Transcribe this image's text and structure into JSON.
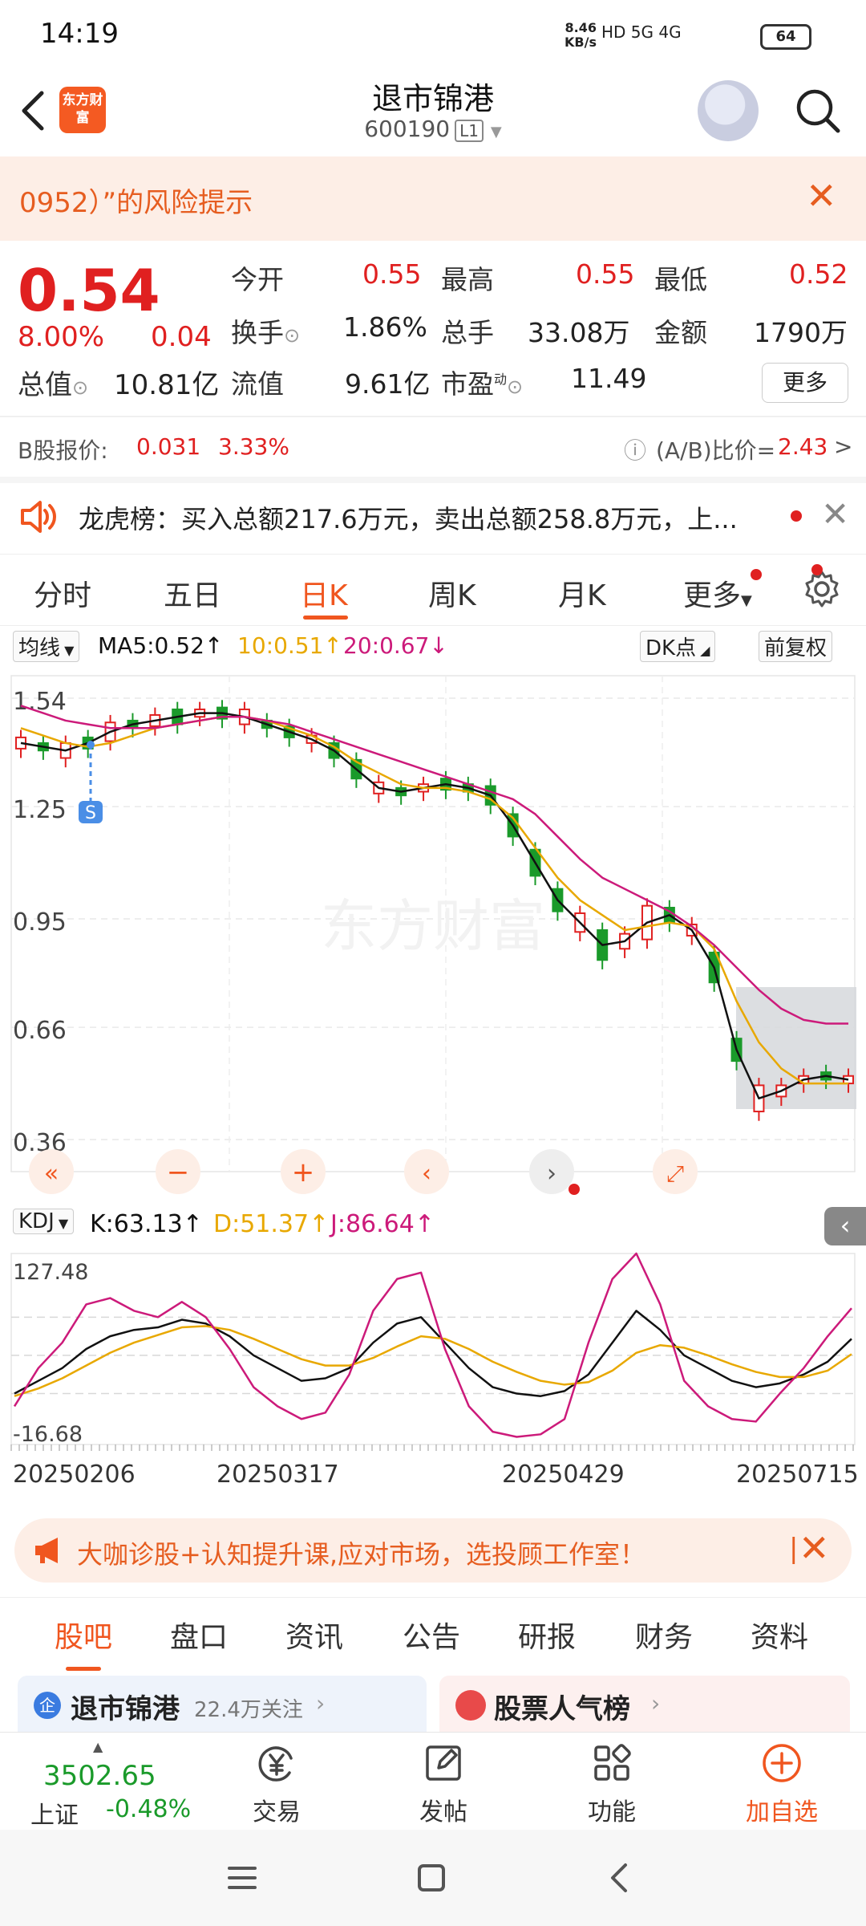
{
  "status_bar": {
    "time": "14:19",
    "net_speed_value": "8.46",
    "net_speed_unit": "KB/s",
    "network": "HD 5G 4G",
    "battery": "64"
  },
  "header": {
    "logo_text": "东方财富",
    "title": "退市锦港",
    "code": "600190",
    "level": "L1"
  },
  "risk_banner": {
    "text": "0952）”的风险提示"
  },
  "quote": {
    "price": "0.54",
    "change_pct": "8.00%",
    "change": "0.04",
    "open_label": "今开",
    "open": "0.55",
    "high_label": "最高",
    "high": "0.55",
    "low_label": "最低",
    "low": "0.52",
    "turnover_label": "换手",
    "turnover": "1.86%",
    "volume_label": "总手",
    "volume": "33.08万",
    "amount_label": "金额",
    "amount": "1790万",
    "mktcap_label": "总值",
    "mktcap": "10.81亿",
    "float_label": "流值",
    "float": "9.61亿",
    "pe_label": "市盈",
    "pe_sup": "动",
    "pe": "11.49",
    "more_label": "更多"
  },
  "b_share": {
    "label": "B股报价:",
    "price": "0.031",
    "pct": "3.33%",
    "ratio_label": "(A/B)比价=",
    "ratio": "2.43",
    "arrow": ">"
  },
  "dragon_list": {
    "text": "龙虎榜：买入总额217.6万元，卖出总额258.8万元，上..."
  },
  "chart_tabs": [
    "分时",
    "五日",
    "日K",
    "周K",
    "月K",
    "更多"
  ],
  "ma_bar": {
    "selector": "均线",
    "ma5": "MA5:0.52",
    "ma10": "10:0.51",
    "ma20": "20:0.67",
    "dk": "DK点",
    "adjust": "前复权"
  },
  "kdj_bar": {
    "selector": "KDJ",
    "k": "K:63.13",
    "d": "D:51.37",
    "j": "J:86.64"
  },
  "colors": {
    "up": "#e02020",
    "down": "#1a9a2a",
    "ma5": "#111111",
    "ma10": "#e8a800",
    "ma20": "#cc1a7a",
    "accent": "#f0561f"
  },
  "chart_data": [
    {
      "type": "candlestick",
      "price_ticks": [
        "1.54",
        "1.25",
        "0.95",
        "0.66",
        "0.36"
      ],
      "marker": "S",
      "ma5": [
        1.42,
        1.41,
        1.4,
        1.42,
        1.45,
        1.47,
        1.48,
        1.49,
        1.5,
        1.5,
        1.49,
        1.47,
        1.45,
        1.43,
        1.4,
        1.35,
        1.3,
        1.29,
        1.3,
        1.31,
        1.3,
        1.28,
        1.2,
        1.1,
        1.0,
        0.94,
        0.88,
        0.89,
        0.94,
        0.96,
        0.92,
        0.82,
        0.6,
        0.47,
        0.49,
        0.52,
        0.53,
        0.52
      ],
      "ma10": [
        1.46,
        1.44,
        1.42,
        1.41,
        1.42,
        1.44,
        1.46,
        1.47,
        1.48,
        1.49,
        1.49,
        1.48,
        1.46,
        1.44,
        1.41,
        1.37,
        1.34,
        1.31,
        1.3,
        1.3,
        1.29,
        1.27,
        1.22,
        1.14,
        1.06,
        1.0,
        0.96,
        0.92,
        0.93,
        0.94,
        0.93,
        0.87,
        0.73,
        0.62,
        0.55,
        0.51,
        0.51,
        0.51
      ],
      "ma20": [
        1.52,
        1.5,
        1.48,
        1.47,
        1.46,
        1.46,
        1.46,
        1.47,
        1.48,
        1.49,
        1.49,
        1.48,
        1.47,
        1.45,
        1.43,
        1.41,
        1.39,
        1.37,
        1.35,
        1.33,
        1.31,
        1.29,
        1.27,
        1.23,
        1.17,
        1.11,
        1.06,
        1.03,
        1.0,
        0.97,
        0.93,
        0.88,
        0.82,
        0.76,
        0.71,
        0.68,
        0.67,
        0.67
      ]
    },
    {
      "type": "line",
      "y_ticks": [
        "127.48",
        "-16.68"
      ],
      "x_ticks": [
        "20250206",
        "20250317",
        "20250429",
        "20250715"
      ],
      "k": [
        20,
        30,
        40,
        55,
        65,
        70,
        72,
        78,
        75,
        65,
        50,
        40,
        30,
        32,
        40,
        60,
        75,
        80,
        60,
        40,
        25,
        20,
        18,
        22,
        35,
        60,
        85,
        70,
        50,
        40,
        30,
        25,
        28,
        35,
        45,
        63
      ],
      "d": [
        18,
        24,
        32,
        42,
        52,
        60,
        66,
        72,
        73,
        70,
        63,
        55,
        47,
        42,
        42,
        48,
        57,
        65,
        63,
        55,
        45,
        37,
        30,
        27,
        29,
        38,
        52,
        58,
        56,
        50,
        43,
        37,
        33,
        33,
        38,
        51
      ],
      "j": [
        10,
        40,
        60,
        90,
        95,
        85,
        80,
        92,
        80,
        55,
        25,
        10,
        0,
        5,
        35,
        85,
        110,
        115,
        55,
        10,
        -10,
        -14,
        -12,
        0,
        60,
        110,
        130,
        90,
        30,
        10,
        0,
        -2,
        20,
        40,
        65,
        87
      ]
    }
  ],
  "ad_banner": {
    "text": "大咖诊股+认知提升课,应对市场，选投顾工作室！"
  },
  "bottom_tabs": [
    "股吧",
    "盘口",
    "资讯",
    "公告",
    "研报",
    "财务",
    "资料"
  ],
  "cards": {
    "left_badge": "企",
    "left_title": "退市锦港",
    "left_sub": "22.4万关注",
    "right_title": "股票人气榜"
  },
  "toolbar": {
    "index_value": "3502.65",
    "index_name": "上证",
    "index_pct": "-0.48%",
    "trade": "交易",
    "post": "发帖",
    "func": "功能",
    "add": "加自选"
  }
}
